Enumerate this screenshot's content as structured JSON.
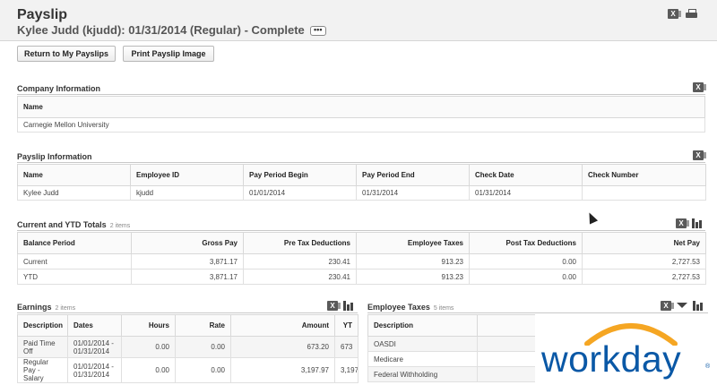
{
  "header": {
    "title": "Payslip",
    "subtitle": "Kylee Judd (kjudd): 01/31/2014 (Regular) - Complete",
    "more_label": "•••"
  },
  "buttons": {
    "return": "Return to My Payslips",
    "print": "Print Payslip Image"
  },
  "company": {
    "title": "Company Information",
    "header": "Name",
    "value": "Carnegie Mellon University"
  },
  "payslip_info": {
    "title": "Payslip Information",
    "headers": [
      "Name",
      "Employee ID",
      "Pay Period Begin",
      "Pay Period End",
      "Check Date",
      "Check Number"
    ],
    "row": [
      "Kylee Judd",
      "kjudd",
      "01/01/2014",
      "01/31/2014",
      "01/31/2014",
      ""
    ]
  },
  "totals": {
    "title": "Current and YTD Totals",
    "count": "2 items",
    "headers": [
      "Balance Period",
      "Gross Pay",
      "Pre Tax Deductions",
      "Employee Taxes",
      "Post Tax Deductions",
      "Net Pay"
    ],
    "rows": [
      [
        "Current",
        "3,871.17",
        "230.41",
        "913.23",
        "0.00",
        "2,727.53"
      ],
      [
        "YTD",
        "3,871.17",
        "230.41",
        "913.23",
        "0.00",
        "2,727.53"
      ]
    ]
  },
  "earnings": {
    "title": "Earnings",
    "count": "2 items",
    "headers": [
      "Description",
      "Dates",
      "Hours",
      "Rate",
      "Amount",
      "YT"
    ],
    "rows": [
      [
        "Paid Time Off",
        "01/01/2014 - 01/31/2014",
        "0.00",
        "0.00",
        "673.20",
        "673"
      ],
      [
        "Regular Pay - Salary",
        "01/01/2014 - 01/31/2014",
        "0.00",
        "0.00",
        "3,197.97",
        "3,197"
      ]
    ]
  },
  "employee_taxes": {
    "title": "Employee Taxes",
    "count": "5 items",
    "header": "Description",
    "rows": [
      "OASDI",
      "Medicare",
      "Federal Withholding"
    ]
  },
  "icons": {
    "excel": "excel-icon",
    "print": "print-icon",
    "chart": "bar-chart-icon",
    "filter": "filter-icon"
  },
  "logo": {
    "text": "workday",
    "mark": "®",
    "text_color": "#0a58a6",
    "arc_color": "#f5a623"
  }
}
